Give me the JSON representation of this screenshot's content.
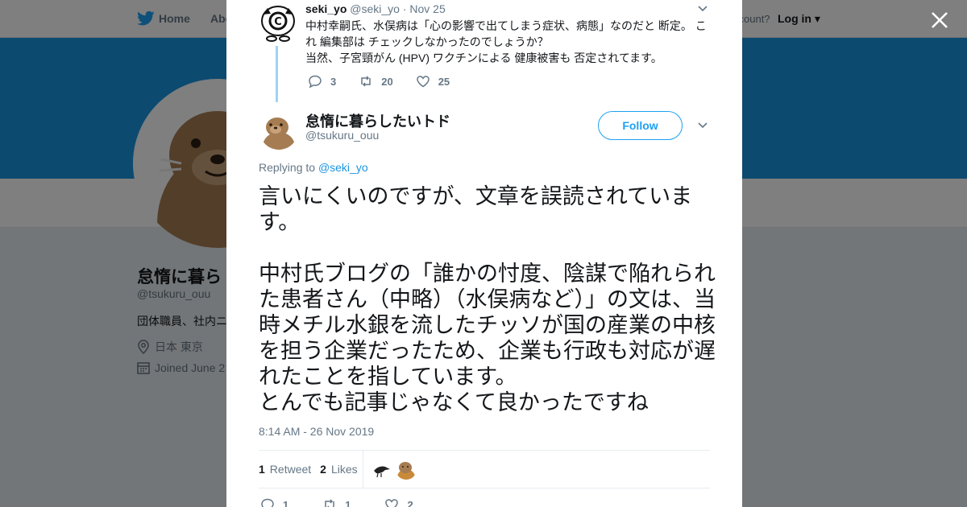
{
  "topbar": {
    "home": "Home",
    "about": "Abo",
    "account": "ccount?",
    "login": "Log in"
  },
  "profile": {
    "name": "怠惰に暮ら",
    "handle": "@tsukuru_ouu",
    "bio": "団体職員、社内ニ",
    "location": "日本 東京",
    "joined": "Joined June 2"
  },
  "parent_tweet": {
    "name": "seki_yo",
    "handle": "@seki_yo",
    "date": "· Nov 25",
    "text": "中村幸嗣氏、水俣病は「心の影響で出てしまう症状、病態」なのだと 断定。 これ 編集部は チェックしなかったのでしょうか？\n当然、子宮頸がん (HPV) ワクチンによる 健康被害も 否定されてます。",
    "replies": "3",
    "retweets": "20",
    "likes": "25"
  },
  "main_tweet": {
    "name": "怠惰に暮らしたいトド",
    "handle": "@tsukuru_ouu",
    "follow_label": "Follow",
    "replying_prefix": "Replying to ",
    "replying_to": "@seki_yo",
    "text": "言いにくいのですが、文章を誤読されています。\n\n中村氏ブログの「誰かの忖度、陰謀で陥れられた患者さん（中略）（水俣病など）」の文は、当時メチル水銀を流したチッソが国の産業の中核を担う企業だったため、企業も行政も対応が遅れたことを指しています。\nとんでも記事じゃなくて良かったですね",
    "timestamp": "8:14 AM - 26 Nov 2019",
    "retweet_count": "1",
    "retweet_label": "Retweet",
    "like_count": "2",
    "like_label": "Likes",
    "replies": "1",
    "retweets": "1",
    "likes": "2"
  },
  "colors": {
    "accent": "#1da1f2",
    "banner": "#1b95e0",
    "thread_line": "#9fd3f5"
  }
}
